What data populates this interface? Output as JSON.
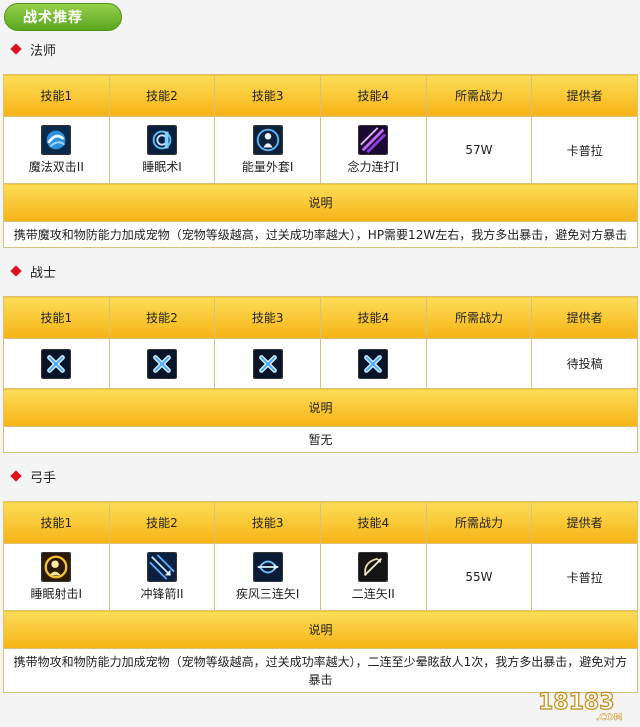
{
  "header": {
    "title": "战术推荐"
  },
  "sections": [
    {
      "title": "法师",
      "columns": [
        "技能1",
        "技能2",
        "技能3",
        "技能4",
        "所需战力",
        "提供者"
      ],
      "skills": [
        {
          "name": "魔法双击II",
          "icon": "magic-double-strike-icon"
        },
        {
          "name": "睡眠术I",
          "icon": "sleep-spell-icon"
        },
        {
          "name": "能量外套I",
          "icon": "energy-coat-icon"
        },
        {
          "name": "念力连打I",
          "icon": "telekinesis-combo-icon"
        }
      ],
      "power": "57W",
      "provider": "卡普拉",
      "desc_label": "说明",
      "desc": "携带魔攻和物防能力加成宠物（宠物等级越高，过关成功率越大），HP需要12W左右，我方多出暴击，避免对方暴击"
    },
    {
      "title": "战士",
      "columns": [
        "技能1",
        "技能2",
        "技能3",
        "技能4",
        "所需战力",
        "提供者"
      ],
      "skills": [
        {
          "name": "",
          "icon": "empty-slot-x-icon"
        },
        {
          "name": "",
          "icon": "empty-slot-x-icon"
        },
        {
          "name": "",
          "icon": "empty-slot-x-icon"
        },
        {
          "name": "",
          "icon": "empty-slot-x-icon"
        }
      ],
      "power": "",
      "provider": "待投稿",
      "desc_label": "说明",
      "desc": "暂无"
    },
    {
      "title": "弓手",
      "columns": [
        "技能1",
        "技能2",
        "技能3",
        "技能4",
        "所需战力",
        "提供者"
      ],
      "skills": [
        {
          "name": "睡眠射击I",
          "icon": "sleep-shot-icon"
        },
        {
          "name": "冲锋箭II",
          "icon": "charge-arrow-icon"
        },
        {
          "name": "疾风三连矢I",
          "icon": "gale-triple-arrow-icon"
        },
        {
          "name": "二连矢II",
          "icon": "double-arrow-icon"
        }
      ],
      "power": "55W",
      "provider": "卡普拉",
      "desc_label": "说明",
      "desc": "携带物攻和物防能力加成宠物（宠物等级越高，过关成功率越大），二连至少晕眩敌人1次，我方多出暴击，避免对方暴击"
    }
  ],
  "watermark": {
    "text": "18183",
    "sub": ".COM"
  }
}
